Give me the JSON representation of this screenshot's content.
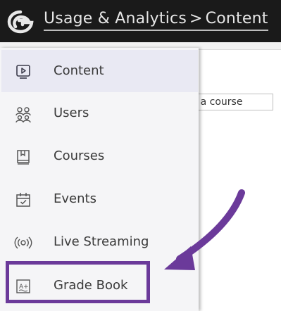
{
  "header": {
    "breadcrumb_root": "Usage & Analytics",
    "breadcrumb_separator": ">",
    "breadcrumb_current": "Content",
    "logo_icon": "brand-logo-icon"
  },
  "background": {
    "course_select_text": "ct a course"
  },
  "sidebar": {
    "items": [
      {
        "label": "Content",
        "icon": "play-video-icon",
        "active": true
      },
      {
        "label": "Users",
        "icon": "users-group-icon",
        "active": false
      },
      {
        "label": "Courses",
        "icon": "book-icon",
        "active": false
      },
      {
        "label": "Events",
        "icon": "calendar-icon",
        "active": false
      },
      {
        "label": "Live Streaming",
        "icon": "broadcast-icon",
        "active": false
      },
      {
        "label": "Grade Book",
        "icon": "grade-book-icon",
        "active": false
      }
    ]
  },
  "annotation": {
    "highlight_color": "#6b3a9a",
    "arrow_color": "#6b3a9a",
    "target": "Grade Book"
  },
  "colors": {
    "header_bg": "#1a1a1a",
    "sidebar_bg": "#f5f5f7",
    "active_bg": "#e9e9f3"
  }
}
